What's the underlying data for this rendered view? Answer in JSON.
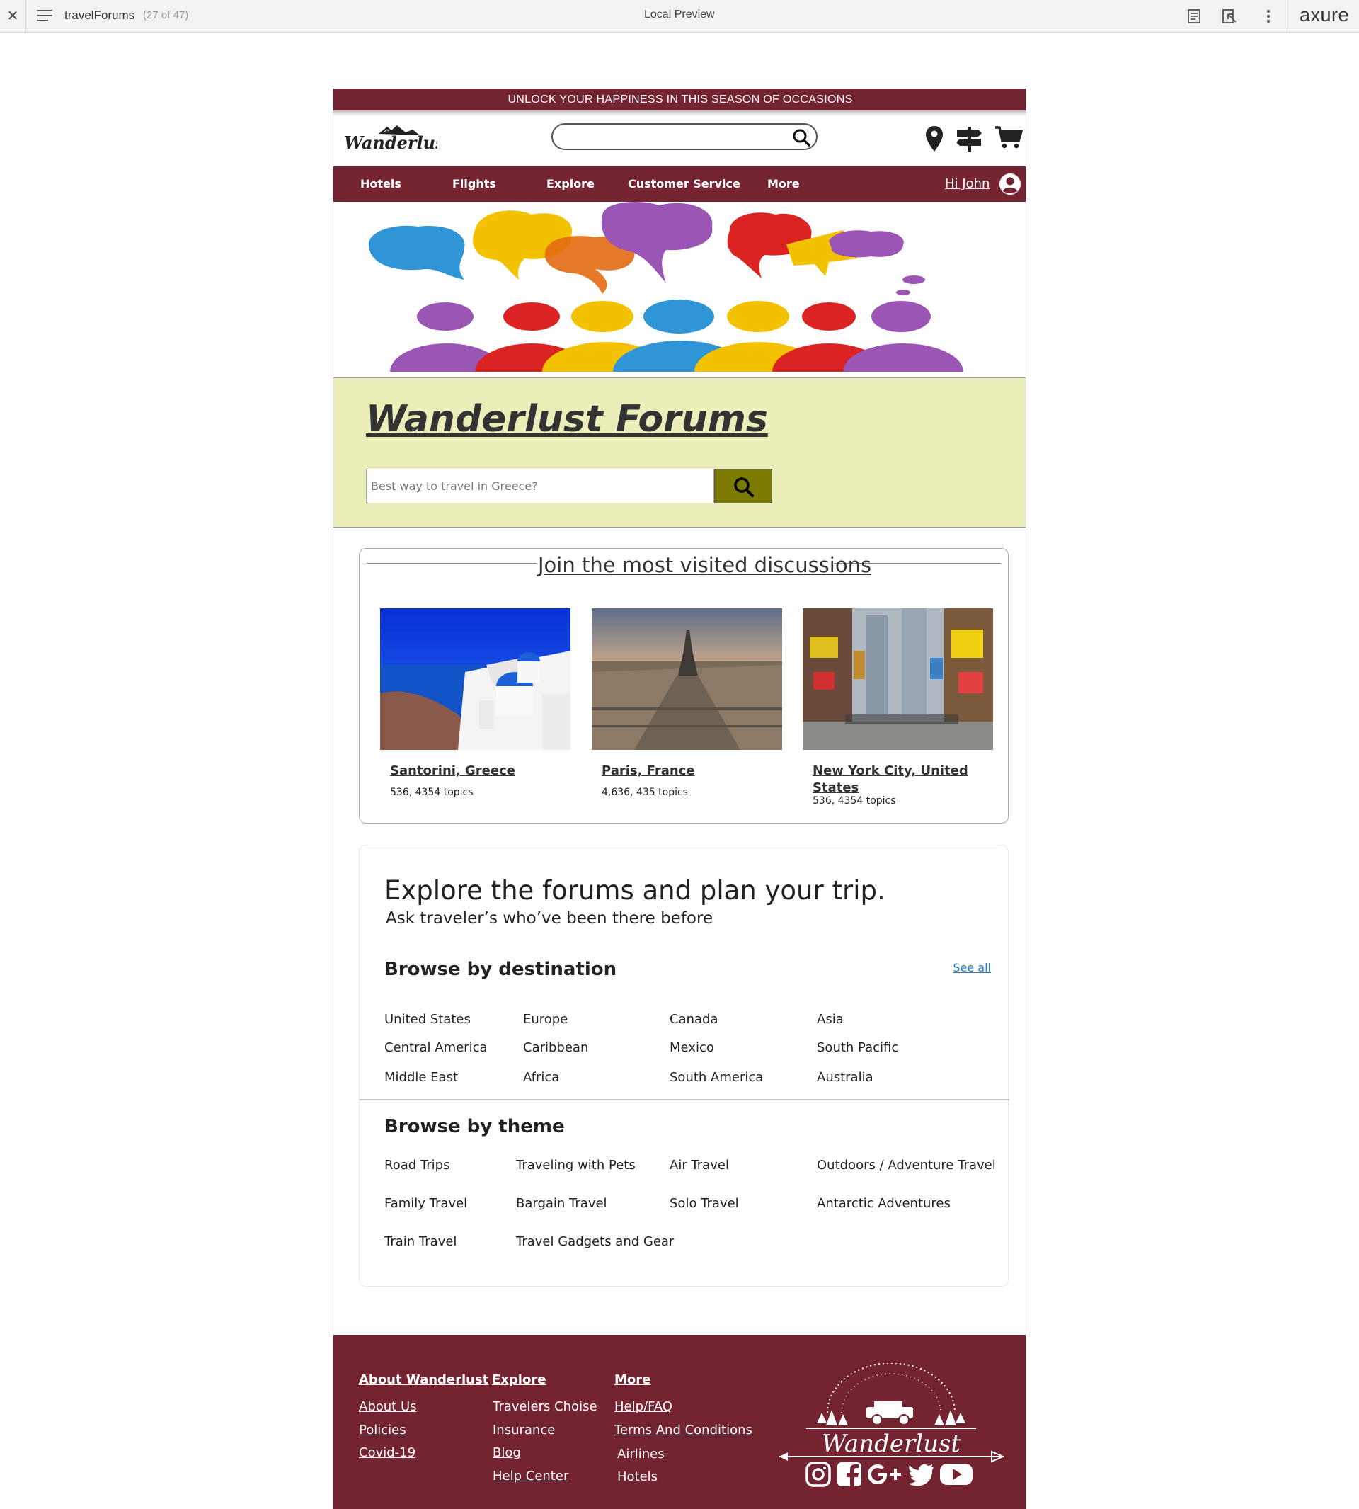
{
  "viewer": {
    "page_title": "travelForums",
    "page_count": "(27 of 47)",
    "center_label": "Local Preview",
    "brand": "axure"
  },
  "promo_banner": "UNLOCK YOUR HAPPINESS IN THIS SEASON OF OCCASIONS",
  "header": {
    "logo_text": "Wanderlust",
    "search_value": ""
  },
  "nav": {
    "items": [
      "Hotels",
      "Flights",
      "Explore",
      "Customer Service",
      "More"
    ],
    "greeting": "Hi John"
  },
  "hero": {
    "title": "Wanderlust Forums",
    "search_placeholder": "Best way to travel in Greece?"
  },
  "popular": {
    "title": "Join the most visited discussions",
    "destinations": [
      {
        "name": "Santorini, Greece",
        "topics": "536, 4354 topics"
      },
      {
        "name": "Paris, France",
        "topics": "4,636, 435 topics"
      },
      {
        "name": "New York City, United States",
        "topics": "536, 4354 topics"
      }
    ]
  },
  "explore": {
    "title": "Explore the forums and plan your trip.",
    "subtitle": "Ask traveler’s who’ve been there before",
    "by_destination": {
      "heading": "Browse by destination",
      "see_all": "See all",
      "items": [
        "United States",
        "Europe",
        "Canada",
        "Asia",
        "Central America",
        "Caribbean",
        "Mexico",
        "South Pacific",
        "Middle East",
        "Africa",
        "South America",
        "Australia"
      ]
    },
    "by_theme": {
      "heading": "Browse by theme",
      "items": [
        "Road Trips",
        "Traveling with Pets",
        "Air Travel",
        "Outdoors / Adventure Travel",
        "Family Travel",
        "Bargain Travel",
        "Solo Travel",
        "Antarctic Adventures",
        "Train Travel",
        "Travel Gadgets and Gear"
      ]
    }
  },
  "footer": {
    "col1": {
      "heading": "About Wanderlust",
      "links": [
        "About Us",
        "Policies",
        "Covid-19"
      ]
    },
    "col2": {
      "heading": "Explore",
      "links": [
        "Travelers Choise",
        "Insurance",
        "Blog",
        "Help Center"
      ]
    },
    "col3": {
      "heading": "More",
      "links": [
        "Help/FAQ",
        "Terms And Conditions",
        "Airlines",
        "Hotels"
      ]
    },
    "logo_text": "Wanderlust",
    "social": [
      "instagram-icon",
      "facebook-icon",
      "google-plus-icon",
      "twitter-icon",
      "youtube-icon"
    ]
  },
  "colors": {
    "brand_maroon": "#732430",
    "hero_bg": "#eceeb9",
    "search_button": "#7c7a00",
    "link_blue": "#2a7fc4"
  }
}
